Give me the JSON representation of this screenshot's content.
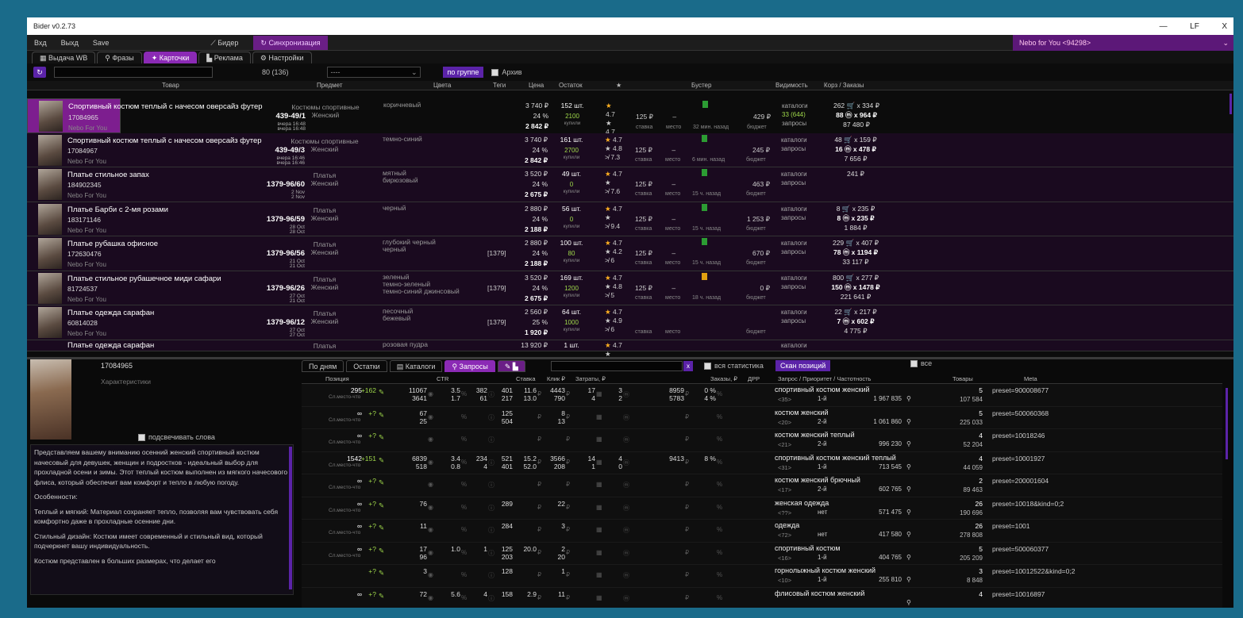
{
  "app": {
    "title": "Bider v0.2.73",
    "controls": [
      "—",
      "LF",
      "X"
    ]
  },
  "toolbar": {
    "login": "Вхд",
    "logout": "Выхд",
    "save": "Save",
    "bidder": "Бидер",
    "sync": "Синхронизация",
    "account": "Nebo for You <94298>"
  },
  "tabs": [
    "Выдача WB",
    "Фразы",
    "Карточки",
    "Реклама",
    "Настройки"
  ],
  "filter": {
    "count": "80 (136)",
    "select": "----",
    "group": "по группе",
    "archive": "Архив"
  },
  "columns": [
    "Товар",
    "Предмет",
    "Цвета",
    "Теги",
    "Цена",
    "Остаток",
    "★",
    "Бустер",
    "Видимость",
    "Корз / Заказы"
  ],
  "products": [
    {
      "name": "Спортивный костюм теплый с начесом оверсайз футер",
      "id": "17084965",
      "brand": "Nebo For You",
      "art": "439-49/1",
      "date1": "вчера 16:48",
      "date2": "вчера 16:48",
      "subject1": "Костюмы спортивные",
      "subject2": "Женский",
      "colors": [
        "коричневый"
      ],
      "tag": "",
      "price": "3 740 ₽",
      "disc": "24 %",
      "final": "2 842 ₽",
      "stock": "152 шт.",
      "stock2": "2100",
      "stock3": "купили",
      "rate": "4.7",
      "rate2": "4.7",
      "rate3": "7.9",
      "bid": "125 ₽",
      "bidtime": "32 мин. назад",
      "budget": "429 ₽",
      "vis1": "каталоги",
      "vis2": "33 (644)",
      "vis3": "запросы",
      "ord1": "262 🛒 x 334 ₽",
      "ord2": "88 ⓜ x 964 ₽",
      "ord3": "87 480 ₽",
      "sel": true,
      "boost": "g"
    },
    {
      "name": "Спортивный костюм теплый с начесом оверсайз футер",
      "id": "17084967",
      "brand": "Nebo For You",
      "art": "439-49/3",
      "date1": "вчера 16:46",
      "date2": "вчера 16:46",
      "subject1": "Костюмы спортивные",
      "subject2": "Женский",
      "colors": [
        "темно-синий"
      ],
      "tag": "",
      "price": "3 740 ₽",
      "disc": "24 %",
      "final": "2 842 ₽",
      "stock": "161 шт.",
      "stock2": "2700",
      "stock3": "купили",
      "rate": "4.7",
      "rate2": "4.8",
      "rate3": "7.3",
      "bid": "125 ₽",
      "bidtime": "6 мин. назад",
      "budget": "245 ₽",
      "vis1": "каталоги",
      "vis2": "",
      "vis3": "запросы",
      "ord1": "48 🛒 x 159 ₽",
      "ord2": "16 ⓜ x 478 ₽",
      "ord3": "7 656 ₽",
      "boost": "g"
    },
    {
      "name": "Платье стильное запах",
      "id": "184902345",
      "brand": "Nebo For You",
      "art": "1379-96/60",
      "date1": "2 Nov",
      "date2": "2 Nov",
      "subject1": "Платья",
      "subject2": "Женский",
      "colors": [
        "мятный",
        "бирюзовый"
      ],
      "tag": "",
      "price": "3 520 ₽",
      "disc": "24 %",
      "final": "2 675 ₽",
      "stock": "49 шт.",
      "stock2": "0",
      "stock3": "купили",
      "rate": "4.7",
      "rate2": "",
      "rate3": "7.6",
      "bid": "125 ₽",
      "bidtime": "15 ч. назад",
      "budget": "463 ₽",
      "vis1": "каталоги",
      "vis2": "",
      "vis3": "запросы",
      "ord1": "",
      "ord2": "",
      "ord3": "241 ₽",
      "boost": "g"
    },
    {
      "name": "Платье Барби с 2-мя розами",
      "id": "183171146",
      "brand": "Nebo For You",
      "art": "1379-96/59",
      "date1": "28 Oct",
      "date2": "28 Oct",
      "subject1": "Платья",
      "subject2": "Женский",
      "colors": [
        "черный"
      ],
      "tag": "",
      "price": "2 880 ₽",
      "disc": "24 %",
      "final": "2 188 ₽",
      "stock": "56 шт.",
      "stock2": "0",
      "stock3": "купили",
      "rate": "4.7",
      "rate2": "",
      "rate3": "9.4",
      "bid": "125 ₽",
      "bidtime": "15 ч. назад",
      "budget": "1 253 ₽",
      "vis1": "каталоги",
      "vis2": "",
      "vis3": "запросы",
      "ord1": "8 🛒 x 235 ₽",
      "ord2": "8 ⓜ x 235 ₽",
      "ord3": "1 884 ₽",
      "boost": "g"
    },
    {
      "name": "Платье рубашка офисное",
      "id": "172630476",
      "brand": "Nebo For You",
      "art": "1379-96/56",
      "date1": "21 Oct",
      "date2": "21 Oct",
      "subject1": "Платья",
      "subject2": "Женский",
      "colors": [
        "глубокий черный",
        "черный"
      ],
      "tag": "[1379]",
      "price": "2 880 ₽",
      "disc": "24 %",
      "final": "2 188 ₽",
      "stock": "100 шт.",
      "stock2": "80",
      "stock3": "купили",
      "rate": "4.7",
      "rate2": "4.2",
      "rate3": "6",
      "bid": "125 ₽",
      "bidtime": "15 ч. назад",
      "budget": "670 ₽",
      "vis1": "каталоги",
      "vis2": "",
      "vis3": "запросы",
      "ord1": "229 🛒 x 407 ₽",
      "ord2": "78 ⓜ x 1194 ₽",
      "ord3": "33 117 ₽",
      "boost": "g"
    },
    {
      "name": "Платье стильное рубашечное миди сафари",
      "id": "81724537",
      "brand": "Nebo For You",
      "art": "1379-96/26",
      "date1": "27 Oct",
      "date2": "21 Oct",
      "subject1": "Платья",
      "subject2": "Женский",
      "colors": [
        "зеленый",
        "темно-зеленый",
        "темно-синий джинсовый"
      ],
      "tag": "[1379]",
      "price": "3 520 ₽",
      "disc": "24 %",
      "final": "2 675 ₽",
      "stock": "169 шт.",
      "stock2": "1200",
      "stock3": "купили",
      "rate": "4.7",
      "rate2": "4.8",
      "rate3": "5",
      "bid": "125 ₽",
      "bidtime": "18 ч. назад",
      "budget": "0 ₽",
      "vis1": "каталоги",
      "vis2": "",
      "vis3": "запросы",
      "ord1": "800 🛒 x 277 ₽",
      "ord2": "150 ⓜ x 1478 ₽",
      "ord3": "221 641 ₽",
      "boost": "y"
    },
    {
      "name": "Платье одежда сарафан",
      "id": "60814028",
      "brand": "Nebo For You",
      "art": "1379-96/12",
      "date1": "27 Oct",
      "date2": "27 Oct",
      "subject1": "Платья",
      "subject2": "Женский",
      "colors": [
        "песочный",
        "бежевый"
      ],
      "tag": "[1379]",
      "price": "2 560 ₽",
      "disc": "25 %",
      "final": "1 920 ₽",
      "stock": "64 шт.",
      "stock2": "1000",
      "stock3": "купили",
      "rate": "4.7",
      "rate2": "4.9",
      "rate3": "6",
      "bid": "",
      "bidtime": "",
      "budget": "",
      "vis1": "каталоги",
      "vis2": "",
      "vis3": "запросы",
      "ord1": "22 🛒 x 217 ₽",
      "ord2": "7 ⓜ x 602 ₽",
      "ord3": "4 775 ₽",
      "boost": ""
    },
    {
      "name": "Платье одежда сарафан",
      "id": "",
      "brand": "",
      "art": "",
      "date1": "",
      "date2": "",
      "subject1": "Платья",
      "subject2": "",
      "colors": [
        "розовая пудра"
      ],
      "tag": "",
      "price": "13 920 ₽",
      "disc": "",
      "final": "",
      "stock": "1 шт.",
      "stock2": "",
      "stock3": "",
      "rate": "4.7",
      "rate2": "",
      "rate3": "",
      "bid": "",
      "bidtime": "",
      "budget": "",
      "vis1": "каталоги",
      "vis2": "",
      "vis3": "",
      "ord1": "",
      "ord2": "",
      "ord3": "",
      "boost": "",
      "half": true
    }
  ],
  "boost_labels": {
    "rate": "ставка",
    "place": "место",
    "budget": "бюджет"
  },
  "detail": {
    "id": "17084965",
    "chars": "Характеристики",
    "highlight": "подсвечивать слова",
    "desc": [
      "Представляем вашему вниманию осенний женский спортивный костюм начесовый для девушек, женщин и подростков - идеальный выбор для прохладной осени и зимы. Этот теплый костюм выполнен из мягкого начесового флиса, который обеспечит вам комфорт и тепло в любую погоду.",
      "Особенности:",
      "Теплый и мягкий: Материал сохраняет тепло, позволяя вам чувствовать себя комфортно даже в прохладные осенние дни.",
      "Стильный дизайн: Костюм имеет современный и стильный вид, который подчеркнет вашу индивидуальность.",
      "Костюм представлен в больших размерах, что делает его"
    ]
  },
  "qtabs": [
    "По дням",
    "Остатки",
    "Каталоги",
    "Запросы"
  ],
  "qctrl": {
    "x": "x",
    "stat": "вся статистика",
    "scan": "Скан позиций",
    "all": "все"
  },
  "qcols": [
    "Позиция",
    "CTR",
    "Ставка",
    "Клик ₽",
    "Затраты, ₽",
    "Заказы, ₽",
    "ДРР",
    "Запрос / Приоритет / Частотность",
    "Товары",
    "Meta"
  ],
  "queries": [
    {
      "pos": "295",
      "sub": "Сл.место-что",
      "delta": "+162",
      "v": [
        [
          "11067",
          "3641"
        ],
        [
          "3.5",
          "1.7"
        ],
        [
          "382",
          "61"
        ],
        [
          "401",
          "217"
        ],
        [
          "11.6",
          "13.0"
        ],
        [
          "4443",
          "790"
        ],
        [
          "17",
          "4"
        ],
        [
          "3",
          "2"
        ],
        [
          "8959",
          "5783"
        ],
        [
          "0 %",
          "4 %"
        ]
      ],
      "name": "спортивный костюм женский",
      "q1": "<35>",
      "q2": "1-й",
      "q3": "1 967 835",
      "p1": "5",
      "p2": "107 584",
      "meta": "preset=900008677"
    },
    {
      "pos": "∞",
      "sub": "Сл.место-что",
      "delta": "+?",
      "v": [
        [
          "67",
          "25"
        ],
        [
          "",
          ""
        ],
        [
          "",
          ""
        ],
        [
          "125",
          "504"
        ],
        [
          "",
          ""
        ],
        [
          "8",
          "13"
        ],
        [
          "",
          ""
        ],
        [
          "",
          ""
        ],
        [
          "",
          ""
        ],
        [
          "",
          ""
        ]
      ],
      "name": "костюм женский",
      "q1": "<20>",
      "q2": "2-й",
      "q3": "1 061 860",
      "p1": "5",
      "p2": "225 033",
      "meta": "preset=500060368"
    },
    {
      "pos": "∞",
      "sub": "Сл.место-что",
      "delta": "+?",
      "v": [
        [
          "",
          ""
        ],
        [
          "",
          ""
        ],
        [
          "",
          ""
        ],
        [
          "",
          ""
        ],
        [
          "",
          ""
        ],
        [
          "",
          ""
        ],
        [
          "",
          ""
        ],
        [
          "",
          ""
        ],
        [
          "",
          ""
        ],
        [
          "",
          ""
        ]
      ],
      "name": "костюм женский теплый",
      "q1": "<21>",
      "q2": "2-й",
      "q3": "996 230",
      "p1": "4",
      "p2": "52 204",
      "meta": "preset=10018246"
    },
    {
      "pos": "1542",
      "sub": "Сл.место-что",
      "delta": "+151",
      "v": [
        [
          "6839",
          "518"
        ],
        [
          "3.4",
          "0.8"
        ],
        [
          "234",
          "4"
        ],
        [
          "521",
          "401"
        ],
        [
          "15.2",
          "52.0"
        ],
        [
          "3566",
          "208"
        ],
        [
          "14",
          "1"
        ],
        [
          "4",
          "0"
        ],
        [
          "9413",
          ""
        ],
        [
          "8 %",
          ""
        ]
      ],
      "name": "спортивный костюм женский теплый",
      "q1": "<31>",
      "q2": "1-й",
      "q3": "713 545",
      "p1": "4",
      "p2": "44 059",
      "meta": "preset=10001927"
    },
    {
      "pos": "∞",
      "sub": "Сл.место-что",
      "delta": "+?",
      "v": [
        [
          "",
          ""
        ],
        [
          "",
          ""
        ],
        [
          "",
          ""
        ],
        [
          "",
          ""
        ],
        [
          "",
          ""
        ],
        [
          "",
          ""
        ],
        [
          "",
          ""
        ],
        [
          "",
          ""
        ],
        [
          "",
          ""
        ],
        [
          "",
          ""
        ]
      ],
      "name": "костюм женский брючный",
      "q1": "<17>",
      "q2": "2-й",
      "q3": "602 765",
      "p1": "2",
      "p2": "89 463",
      "meta": "preset=200001604"
    },
    {
      "pos": "∞",
      "sub": "Сл.место-что",
      "delta": "+?",
      "v": [
        [
          "",
          "76"
        ],
        [
          "",
          ""
        ],
        [
          "",
          ""
        ],
        [
          "",
          "289"
        ],
        [
          "",
          ""
        ],
        [
          "",
          "22"
        ],
        [
          "",
          ""
        ],
        [
          "",
          ""
        ],
        [
          "",
          ""
        ],
        [
          "",
          ""
        ]
      ],
      "name": "женская одежда",
      "q1": "<??>",
      "q2": "нет",
      "q3": "571 475",
      "p1": "26",
      "p2": "190 696",
      "meta": "preset=10018&kind=0;2"
    },
    {
      "pos": "∞",
      "sub": "Сл.место-что",
      "delta": "+?",
      "v": [
        [
          "",
          "11"
        ],
        [
          "",
          ""
        ],
        [
          "",
          ""
        ],
        [
          "",
          "284"
        ],
        [
          "",
          ""
        ],
        [
          "",
          "3"
        ],
        [
          "",
          ""
        ],
        [
          "",
          ""
        ],
        [
          "",
          ""
        ],
        [
          "",
          ""
        ]
      ],
      "name": "одежда",
      "q1": "<72>",
      "q2": "нет",
      "q3": "417 580",
      "p1": "26",
      "p2": "278 808",
      "meta": "preset=1001"
    },
    {
      "pos": "∞",
      "sub": "Сл.место-что",
      "delta": "+?",
      "v": [
        [
          "17",
          "96"
        ],
        [
          "",
          "1.0"
        ],
        [
          "",
          "1"
        ],
        [
          "125",
          "203"
        ],
        [
          "",
          "20.0"
        ],
        [
          "2",
          "20"
        ],
        [
          "",
          ""
        ],
        [
          "",
          ""
        ],
        [
          "",
          ""
        ],
        [
          "",
          ""
        ]
      ],
      "name": "спортивный костюм",
      "q1": "<16>",
      "q2": "1-й",
      "q3": "404 765",
      "p1": "5",
      "p2": "205 209",
      "meta": "preset=500060377"
    },
    {
      "pos": "",
      "sub": "",
      "delta": "+?",
      "v": [
        [
          "3",
          ""
        ],
        [
          "",
          ""
        ],
        [
          "",
          ""
        ],
        [
          "128",
          ""
        ],
        [
          "",
          ""
        ],
        [
          "1",
          ""
        ],
        [
          "",
          ""
        ],
        [
          "",
          ""
        ],
        [
          "",
          ""
        ],
        [
          "",
          ""
        ]
      ],
      "name": "горнолыжный костюм женский",
      "q1": "<10>",
      "q2": "1-й",
      "q3": "255 810",
      "p1": "3",
      "p2": "8 848",
      "meta": "preset=10012522&kind=0;2"
    },
    {
      "pos": "∞",
      "sub": "",
      "delta": "+?",
      "v": [
        [
          "72",
          ""
        ],
        [
          "5.6",
          ""
        ],
        [
          "4",
          ""
        ],
        [
          "158",
          ""
        ],
        [
          "2.9",
          ""
        ],
        [
          "11",
          ""
        ],
        [
          "",
          ""
        ],
        [
          "",
          ""
        ],
        [
          "",
          ""
        ],
        [
          "",
          ""
        ]
      ],
      "name": "флисовый костюм женский",
      "q1": "",
      "q2": "",
      "q3": "",
      "p1": "4",
      "p2": "",
      "meta": "preset=10016897"
    }
  ]
}
